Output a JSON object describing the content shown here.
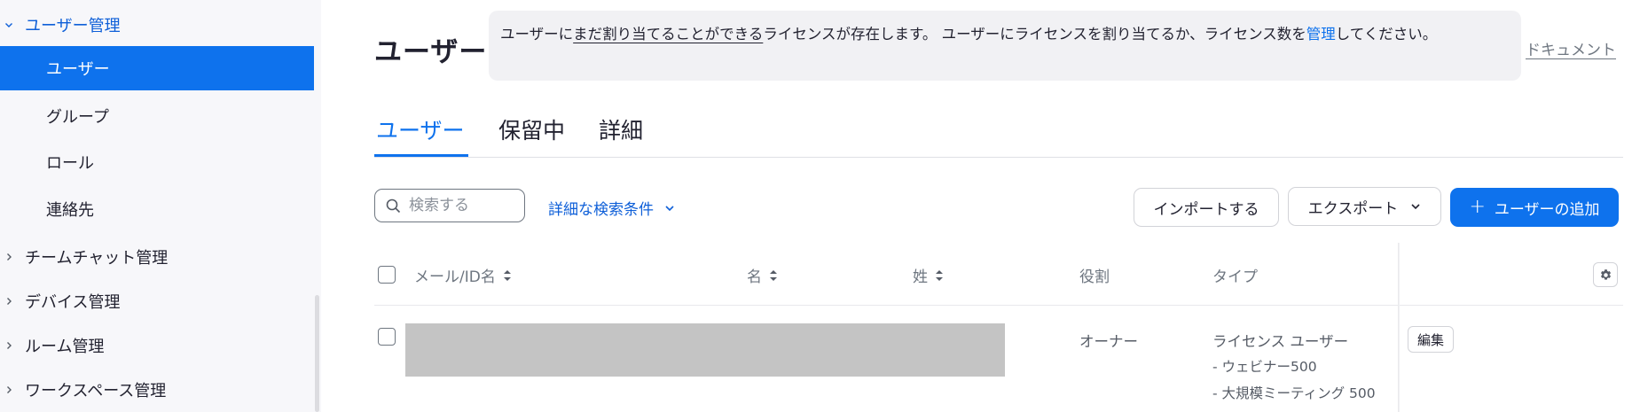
{
  "sidebar": {
    "section_user_mgmt": "ユーザー管理",
    "items": [
      {
        "label": "ユーザー"
      },
      {
        "label": "グループ"
      },
      {
        "label": "ロール"
      },
      {
        "label": "連絡先"
      }
    ],
    "sections": [
      {
        "label": "チームチャット管理"
      },
      {
        "label": "デバイス管理"
      },
      {
        "label": "ルーム管理"
      },
      {
        "label": "ワークスペース管理"
      }
    ]
  },
  "header": {
    "title": "ユーザー",
    "notice": {
      "part1": "ユーザーに",
      "underlined": "まだ割り当てることができる",
      "part2": "ライセンスが存在します。 ユーザーにライセンスを割り当てるか、ライセンス数を",
      "link": "管理",
      "part3": "してください。"
    },
    "doc_link": "ドキュメント"
  },
  "tabs": [
    {
      "label": "ユーザー",
      "active": true
    },
    {
      "label": "保留中",
      "active": false
    },
    {
      "label": "詳細",
      "active": false
    }
  ],
  "toolbar": {
    "search_placeholder": "検索する",
    "advanced_search": "詳細な検索条件",
    "import_label": "インポートする",
    "export_label": "エクスポート",
    "add_user_label": "ユーザーの追加"
  },
  "table": {
    "columns": {
      "email": "メール/ID名",
      "first_name": "名",
      "last_name": "姓",
      "role": "役割",
      "type": "タイプ"
    },
    "rows": [
      {
        "role": "オーナー",
        "type": "ライセンス ユーザー",
        "addons": [
          "- ウェビナー500",
          "- 大規模ミーティング 500"
        ],
        "edit_label": "編集"
      }
    ]
  },
  "colors": {
    "accent": "#0e72ed",
    "sidebar_bg": "#f7f7fa",
    "notice_bg": "#f1f1f4",
    "redacted": "#c4c4c4"
  }
}
